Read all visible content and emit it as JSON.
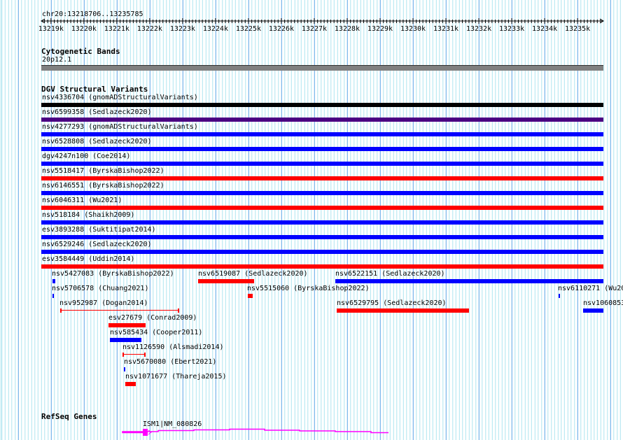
{
  "location": "chr20:13218706..13235785",
  "ruler": {
    "start": 13218706,
    "end": 13235785,
    "ticks": [
      "13219k",
      "13220k",
      "13221k",
      "13222k",
      "13223k",
      "13224k",
      "13225k",
      "13226k",
      "13227k",
      "13228k",
      "13229k",
      "13230k",
      "13231k",
      "13232k",
      "13233k",
      "13234k",
      "13235k"
    ]
  },
  "cytoband": {
    "title": "Cytogenetic Bands",
    "band": "20p12.1",
    "color": "#808080"
  },
  "dgv": {
    "title": "DGV Structural Variants",
    "full_rows": [
      {
        "label": "nsv4336704 (gnomADStructuralVariants)",
        "color": "#000000"
      },
      {
        "label": "nsv6599358 (Sedlazeck2020)",
        "color": "#4b0082"
      },
      {
        "label": "nsv4277293 (gnomADStructuralVariants)",
        "color": "#0000ff"
      },
      {
        "label": "nsv6528808 (Sedlazeck2020)",
        "color": "#0000ff"
      },
      {
        "label": "dgv4247n100 (Coe2014)",
        "color": "#0000ff"
      },
      {
        "label": "nsv5518417 (ByrskaBishop2022)",
        "color": "#ff0000"
      },
      {
        "label": "nsv6146551 (ByrskaBishop2022)",
        "color": "#0000ff"
      },
      {
        "label": "nsv6046311 (Wu2021)",
        "color": "#ff0000"
      },
      {
        "label": "nsv518184 (Shaikh2009)",
        "color": "#0000ff"
      },
      {
        "label": "esv3893288 (Suktitipat2014)",
        "color": "#0000ff"
      },
      {
        "label": "nsv6529246 (Sedlazeck2020)",
        "color": "#0000ff"
      },
      {
        "label": "esv3584449 (Uddin2014)",
        "color": "#ff0000"
      }
    ],
    "features": [
      {
        "label": "nsv5427083 (ByrskaBishop2022)",
        "color": "#0000ff"
      },
      {
        "label": "nsv6519087 (Sedlazeck2020)",
        "color": "#ff0000"
      },
      {
        "label": "nsv6522151 (Sedlazeck2020)",
        "color": "#0000ff"
      },
      {
        "label": "nsv5706578 (Chuang2021)",
        "color": "#0000ff"
      },
      {
        "label": "nsv5515060 (ByrskaBishop2022)",
        "color": "#ff0000"
      },
      {
        "label": "nsv6110271 (Wu20",
        "color": "#0000ff"
      },
      {
        "label": "nsv952987 (Dogan2014)",
        "color": "#ff0000"
      },
      {
        "label": "nsv6529795 (Sedlazeck2020)",
        "color": "#ff0000"
      },
      {
        "label": "nsv1060853",
        "color": "#0000ff"
      },
      {
        "label": "esv27679 (Conrad2009)",
        "color": "#ff0000"
      },
      {
        "label": "nsv585434 (Cooper2011)",
        "color": "#0000ff"
      },
      {
        "label": "nsv1126590 (Alsmadi2014)",
        "color": "#ff0000"
      },
      {
        "label": "nsv5670080 (Ebert2021)",
        "color": "#0000ff"
      },
      {
        "label": "nsv1071677 (Thareja2015)",
        "color": "#ff0000"
      }
    ]
  },
  "refseq": {
    "title": "RefSeq Genes",
    "gene_label": "ISM1|NM_080826",
    "color": "#ff00ff"
  }
}
